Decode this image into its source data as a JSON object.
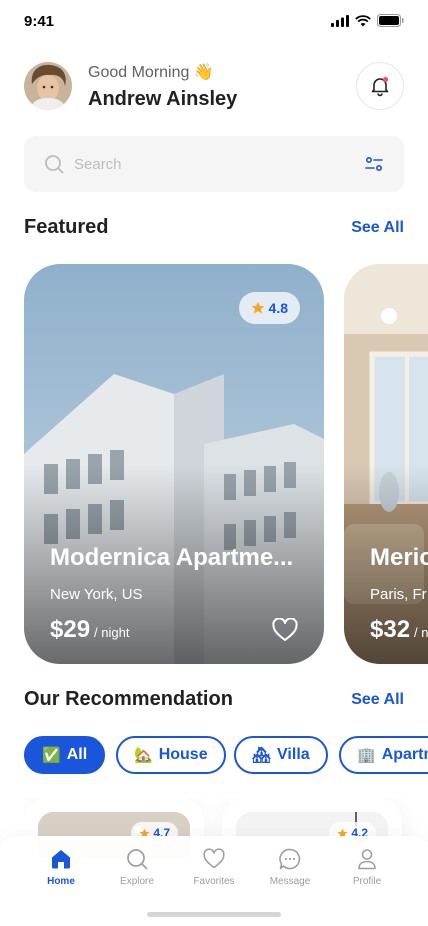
{
  "status_bar": {
    "time": "9:41"
  },
  "header": {
    "greeting": "Good Morning 👋",
    "user_name": "Andrew Ainsley"
  },
  "search": {
    "placeholder": "Search",
    "value": ""
  },
  "featured": {
    "title": "Featured",
    "see_all": "See All",
    "items": [
      {
        "name": "Modernica Apartme...",
        "location": "New York, US",
        "price": "$29",
        "unit": "/ night",
        "rating": "4.8"
      },
      {
        "name": "Merica",
        "location": "Paris, Fr",
        "price": "$32",
        "unit": "/ n"
      }
    ]
  },
  "recommendation": {
    "title": "Our Recommendation",
    "see_all": "See All",
    "chips": [
      {
        "emoji": "✅",
        "label": "All",
        "active": true
      },
      {
        "emoji": "🏡",
        "label": "House",
        "active": false
      },
      {
        "emoji": "🏘",
        "label": "Villa",
        "active": false
      },
      {
        "emoji": "🏢",
        "label": "Apartm",
        "active": false
      }
    ],
    "items": [
      {
        "rating": "4.7"
      },
      {
        "rating": "4.2"
      }
    ]
  },
  "nav": {
    "items": [
      {
        "label": "Home",
        "icon": "home-icon",
        "active": true
      },
      {
        "label": "Explore",
        "icon": "search-icon",
        "active": false
      },
      {
        "label": "Favorites",
        "icon": "heart-icon",
        "active": false
      },
      {
        "label": "Message",
        "icon": "chat-icon",
        "active": false
      },
      {
        "label": "Profile",
        "icon": "user-icon",
        "active": false
      }
    ]
  },
  "colors": {
    "primary": "#1a56db",
    "star": "#f5a623",
    "text": "#212121"
  }
}
